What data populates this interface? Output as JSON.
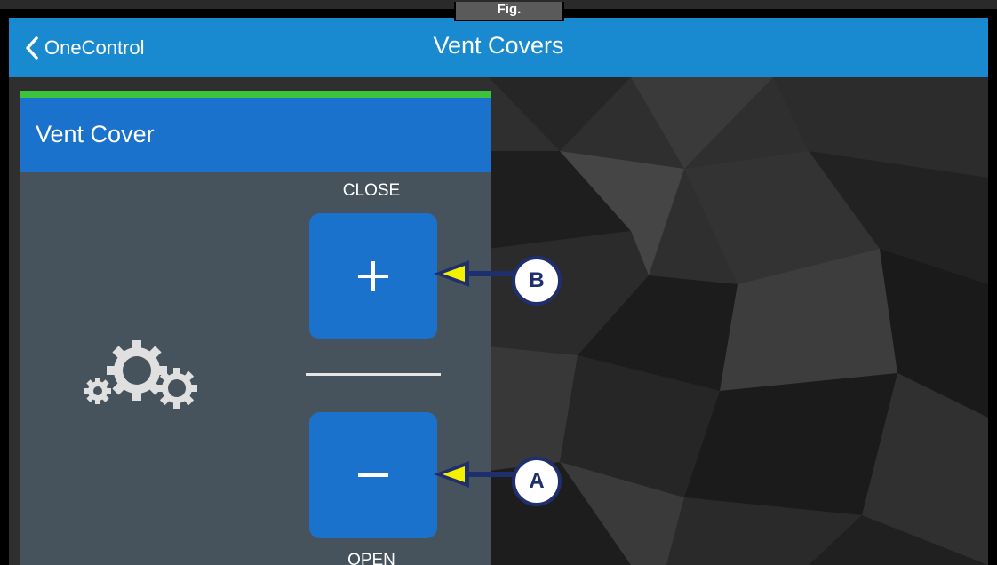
{
  "tab": {
    "label": "Fig."
  },
  "header": {
    "back_label": "OneControl",
    "title": "Vent Covers"
  },
  "panel": {
    "title": "Vent Cover",
    "close_label": "CLOSE",
    "open_label": "OPEN",
    "plus_button": "+",
    "minus_button": "−"
  },
  "callouts": {
    "a": "A",
    "b": "B"
  },
  "colors": {
    "header": "#1a8ad0",
    "panel_head": "#1b72cc",
    "panel_body": "#47535c",
    "accent_bar": "#3cc33c",
    "callout_arrow": "#1f2f6e",
    "callout_tip": "#f5f000"
  }
}
